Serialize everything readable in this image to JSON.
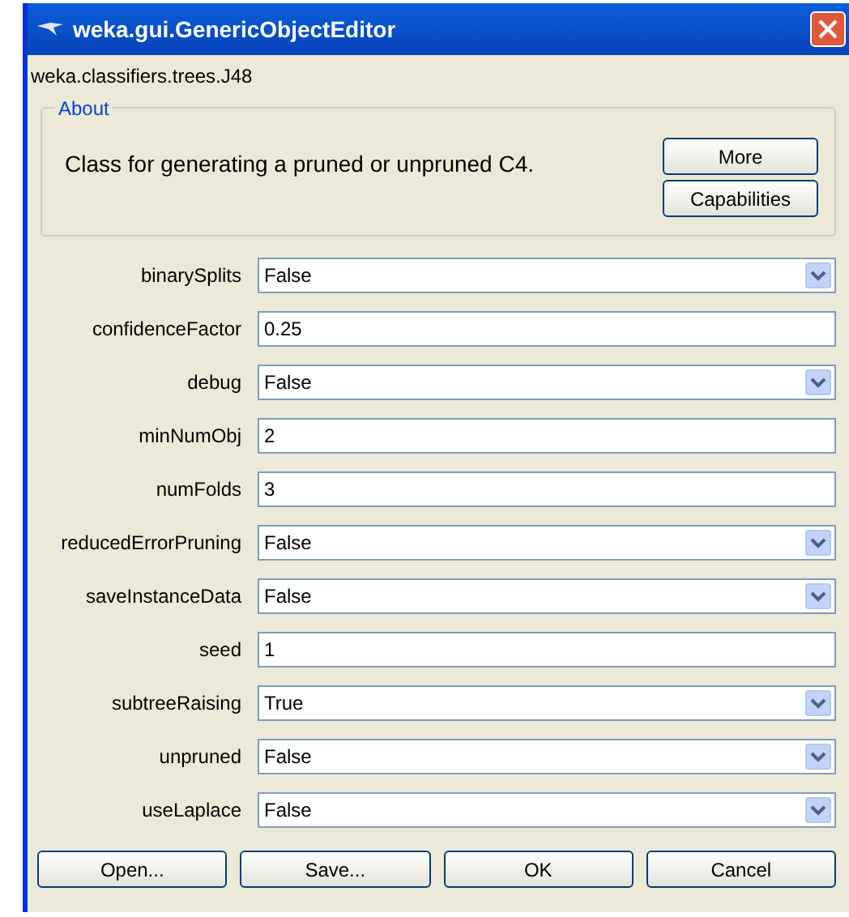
{
  "window": {
    "title": "weka.gui.GenericObjectEditor"
  },
  "class_name": "weka.classifiers.trees.J48",
  "about": {
    "legend": "About",
    "description": "Class for generating a pruned or unpruned C4.",
    "buttons": [
      "More",
      "Capabilities"
    ]
  },
  "properties": [
    {
      "name": "binarySplits",
      "kind": "dropdown",
      "value": "False"
    },
    {
      "name": "confidenceFactor",
      "kind": "text",
      "value": "0.25"
    },
    {
      "name": "debug",
      "kind": "dropdown",
      "value": "False"
    },
    {
      "name": "minNumObj",
      "kind": "text",
      "value": "2"
    },
    {
      "name": "numFolds",
      "kind": "text",
      "value": "3"
    },
    {
      "name": "reducedErrorPruning",
      "kind": "dropdown",
      "value": "False"
    },
    {
      "name": "saveInstanceData",
      "kind": "dropdown",
      "value": "False"
    },
    {
      "name": "seed",
      "kind": "text",
      "value": "1"
    },
    {
      "name": "subtreeRaising",
      "kind": "dropdown",
      "value": "True"
    },
    {
      "name": "unpruned",
      "kind": "dropdown",
      "value": "False"
    },
    {
      "name": "useLaplace",
      "kind": "dropdown",
      "value": "False"
    }
  ],
  "buttons": [
    "Open...",
    "Save...",
    "OK",
    "Cancel"
  ]
}
